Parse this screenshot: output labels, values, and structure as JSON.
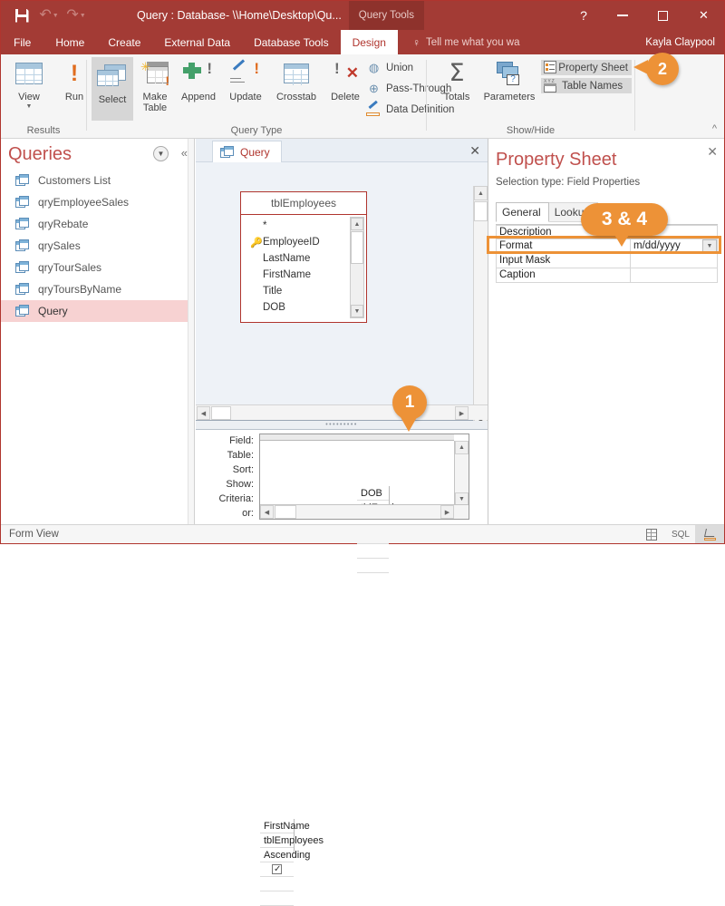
{
  "titlebar": {
    "save_icon": "save-icon",
    "undo_icon": "undo-icon",
    "redo_icon": "redo-icon",
    "window_title": "Query : Database- \\\\Home\\Desktop\\Qu...",
    "contextual_tab_group": "Query Tools",
    "help_label": "?",
    "minimize_label": "–",
    "restore_label": "□",
    "close_label": "✕"
  },
  "tabs": {
    "items": [
      {
        "label": "File",
        "active": false
      },
      {
        "label": "Home",
        "active": false
      },
      {
        "label": "Create",
        "active": false
      },
      {
        "label": "External Data",
        "active": false
      },
      {
        "label": "Database Tools",
        "active": false
      },
      {
        "label": "Design",
        "active": true
      }
    ],
    "tell_me": "Tell me what you wa",
    "user_name": "Kayla Claypool"
  },
  "ribbon": {
    "groups": [
      {
        "label": "Results"
      },
      {
        "label": "Query Type"
      },
      {
        "label": "Show/Hide"
      }
    ],
    "results": [
      {
        "label": "View",
        "icon": "table-view-icon",
        "has_dropdown": true
      },
      {
        "label": "Run",
        "icon": "run-exclamation-icon",
        "has_dropdown": false
      }
    ],
    "query_type": [
      {
        "label": "Select",
        "icon": "select-query-icon",
        "selected": true
      },
      {
        "label": "Make Table",
        "icon": "make-table-query-icon",
        "selected": false
      },
      {
        "label": "Append",
        "icon": "append-query-icon",
        "selected": false
      },
      {
        "label": "Update",
        "icon": "update-query-icon",
        "selected": false
      },
      {
        "label": "Crosstab",
        "icon": "crosstab-query-icon",
        "selected": false
      },
      {
        "label": "Delete",
        "icon": "delete-query-icon",
        "selected": false
      }
    ],
    "query_type_small": [
      {
        "label": "Union",
        "icon": "union-icon"
      },
      {
        "label": "Pass-Through",
        "icon": "pass-through-globe-icon"
      },
      {
        "label": "Data Definition",
        "icon": "data-definition-icon"
      }
    ],
    "show_hide": [
      {
        "label": "Totals",
        "icon": "sigma-totals-icon"
      },
      {
        "label": "Parameters",
        "icon": "parameters-icon"
      }
    ],
    "show_hide_toggles": [
      {
        "label": "Property Sheet",
        "icon": "property-sheet-icon",
        "active": true
      },
      {
        "label": "Table Names",
        "icon": "table-names-icon",
        "active": true
      }
    ],
    "collapse_label": "^"
  },
  "nav_pane": {
    "title": "Queries",
    "dropdown_icon": "chevron-down-icon",
    "collapse_icon": "double-chevron-left-icon",
    "items": [
      {
        "label": "Customers List",
        "selected": false
      },
      {
        "label": "qryEmployeeSales",
        "selected": false
      },
      {
        "label": "qryRebate",
        "selected": false
      },
      {
        "label": "qrySales",
        "selected": false
      },
      {
        "label": "qryTourSales",
        "selected": false
      },
      {
        "label": "qryToursByName",
        "selected": false
      },
      {
        "label": "Query",
        "selected": true
      }
    ]
  },
  "document": {
    "tab_label": "Query",
    "tab_icon": "query-object-icon",
    "close_label": "✕",
    "table_box": {
      "title": "tblEmployees",
      "fields": [
        {
          "name": "*",
          "primary_key": false
        },
        {
          "name": "EmployeeID",
          "primary_key": true
        },
        {
          "name": "LastName",
          "primary_key": false
        },
        {
          "name": "FirstName",
          "primary_key": false
        },
        {
          "name": "Title",
          "primary_key": false
        },
        {
          "name": "DOB",
          "primary_key": false
        }
      ]
    },
    "qbe": {
      "row_labels": [
        "Field:",
        "Table:",
        "Sort:",
        "Show:",
        "Criteria:",
        "or:"
      ],
      "columns": [
        {
          "field": "FirstName",
          "table": "tblEmployees",
          "sort": "Ascending",
          "show": true,
          "criteria": "",
          "or": ""
        },
        {
          "field": "DOB",
          "table": "tblEmployees",
          "sort": "",
          "show": true,
          "criteria": "",
          "or": ""
        }
      ]
    }
  },
  "property_sheet": {
    "title": "Property Sheet",
    "subtitle": "Selection type:  Field Properties",
    "close_label": "✕",
    "tabs": [
      {
        "label": "General",
        "selected": true
      },
      {
        "label": "Lookup",
        "selected": false
      }
    ],
    "rows": [
      {
        "name": "Description",
        "value": "",
        "has_dropdown": false
      },
      {
        "name": "Format",
        "value": "m/dd/yyyy",
        "has_dropdown": true
      },
      {
        "name": "Input Mask",
        "value": "",
        "has_dropdown": false
      },
      {
        "name": "Caption",
        "value": "",
        "has_dropdown": false
      }
    ]
  },
  "callouts": [
    {
      "label": "1",
      "target": "qbe-dob-column"
    },
    {
      "label": "2",
      "target": "property-sheet-ribbon-button"
    },
    {
      "label": "3 & 4",
      "target": "format-property-row"
    }
  ],
  "status_bar": {
    "text": "Form View",
    "views": [
      {
        "icon": "datasheet-view-icon",
        "active": false
      },
      {
        "icon": "sql-view-icon",
        "label": "SQL",
        "active": false
      },
      {
        "icon": "design-view-icon",
        "active": true
      }
    ]
  },
  "colors": {
    "accent_red": "#a33b35",
    "callout_orange": "#ed9237",
    "selection_pink": "#f7d2d2",
    "title_red": "#c0504d"
  }
}
